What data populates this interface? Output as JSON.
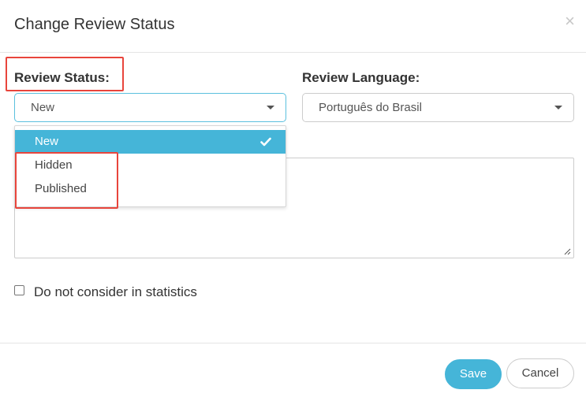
{
  "dialog": {
    "title": "Change Review Status",
    "close_icon": "×"
  },
  "review_status": {
    "label": "Review Status:",
    "selected": "New",
    "options": [
      {
        "label": "New",
        "selected": true
      },
      {
        "label": "Hidden",
        "selected": false
      },
      {
        "label": "Published",
        "selected": false
      }
    ]
  },
  "review_language": {
    "label": "Review Language:",
    "selected": "Português do Brasil"
  },
  "comment": {
    "value": ""
  },
  "statistics_checkbox": {
    "label": "Do not consider in statistics",
    "checked": false
  },
  "footer": {
    "save_label": "Save",
    "cancel_label": "Cancel"
  },
  "colors": {
    "accent": "#45b5d8",
    "highlight": "#e8453c"
  },
  "icons": {
    "close": "close-icon",
    "caret": "caret-down-icon",
    "check": "check-icon",
    "resize": "resize-grip-icon"
  }
}
